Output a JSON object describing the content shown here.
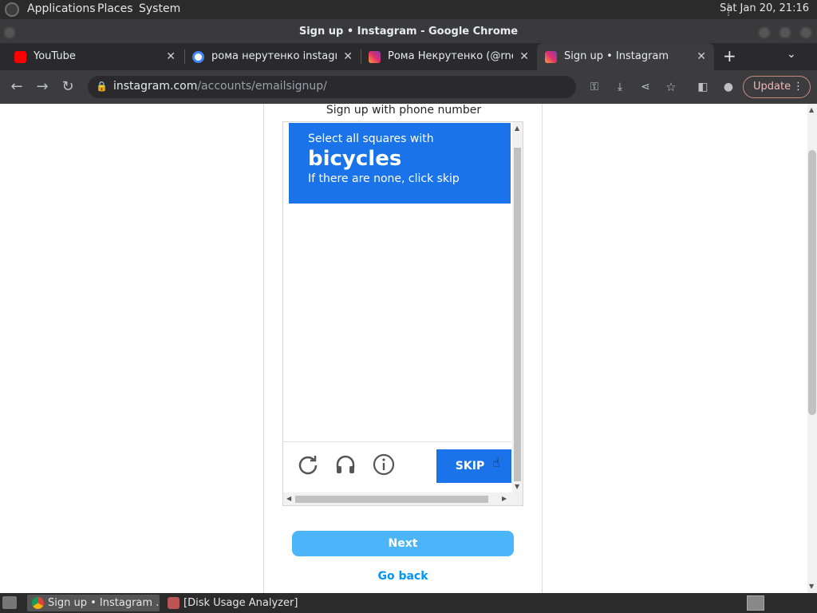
{
  "system_panel": {
    "menus": [
      "Applications",
      "Places",
      "System"
    ],
    "clock": "Sat Jan 20, 21:16"
  },
  "window": {
    "title": "Sign up • Instagram - Google Chrome"
  },
  "tabs": [
    {
      "label": "YouTube",
      "icon": "youtube-icon",
      "active": false
    },
    {
      "label": "рома нерутенко instagram",
      "icon": "google-icon",
      "active": false
    },
    {
      "label": "Рома Некрутенко (@rnekr",
      "icon": "instagram-icon",
      "active": false
    },
    {
      "label": "Sign up • Instagram",
      "icon": "instagram-icon",
      "active": true
    }
  ],
  "tab_close": "✕",
  "new_tab": "+",
  "address_bar": {
    "domain": "instagram.com",
    "path": "/accounts/emailsignup/",
    "update_label": "Update"
  },
  "page": {
    "signup_phone": "Sign up with phone number",
    "captcha": {
      "line1": "Select all squares with",
      "target": "bicycles",
      "line3": "If there are none, click skip",
      "skip_label": "SKIP"
    },
    "next_label": "Next",
    "go_back_label": "Go back"
  },
  "taskbar": {
    "items": [
      {
        "label": "Sign up • Instagram ...",
        "active": true
      },
      {
        "label": "[Disk Usage Analyzer]",
        "active": false
      }
    ]
  },
  "colors": {
    "captcha_blue": "#1a73e8",
    "next_button": "#4cb5f9",
    "link_blue": "#0095f6"
  }
}
